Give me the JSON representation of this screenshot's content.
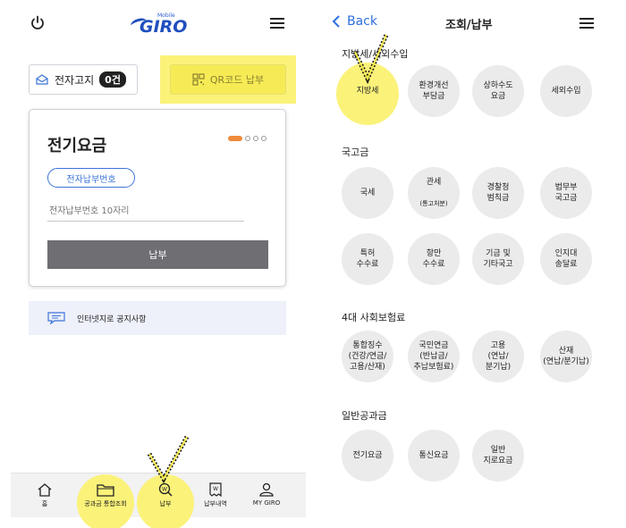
{
  "left": {
    "logo": {
      "small": "Mobile",
      "brand": "GIRO"
    },
    "e_notice": {
      "label": "전자고지",
      "count": "0건"
    },
    "qr_button": {
      "label": "QR코드 납부"
    },
    "card": {
      "title": "전기요금",
      "e_pay_number_label": "전자납부번호",
      "input_placeholder": "전자납부번호 10자리",
      "pay_label": "납부"
    },
    "notice": {
      "label": "인터넷지로 공지사항"
    },
    "bottom_nav": [
      {
        "label": "홈"
      },
      {
        "label": "공과금 통합조회"
      },
      {
        "label": "납부"
      },
      {
        "label": "납부내역"
      },
      {
        "label": "MY GIRO"
      }
    ]
  },
  "right": {
    "back_label": "Back",
    "title": "조회/납부",
    "sections": [
      {
        "title": "지방세/세외수입",
        "items": [
          {
            "label": "지방세"
          },
          {
            "label": "환경개선\n부담금"
          },
          {
            "label": "상하수도\n요금"
          },
          {
            "label": "세외수입"
          }
        ]
      },
      {
        "title": "국고금",
        "items": [
          {
            "label": "국세"
          },
          {
            "label": "관세",
            "sub": "(통고처분)"
          },
          {
            "label": "경찰청\n범칙금"
          },
          {
            "label": "법무부\n국고금"
          },
          {
            "label": "특허\n수수료"
          },
          {
            "label": "항만\n수수료"
          },
          {
            "label": "기금 및\n기타국고"
          },
          {
            "label": "인지대\n송달료"
          }
        ]
      },
      {
        "title": "4대 사회보험료",
        "items": [
          {
            "label": "통합징수\n(건강/연금/\n고용/산재)"
          },
          {
            "label": "국민연금\n(반납금/\n추납보험료)"
          },
          {
            "label": "고용\n(연납/\n분기납)"
          },
          {
            "label": "산재\n(연납/분기납)"
          }
        ]
      },
      {
        "title": "일반공과금",
        "items": [
          {
            "label": "전기요금"
          },
          {
            "label": "통신요금"
          },
          {
            "label": "일반\n지로요금"
          }
        ]
      }
    ]
  },
  "colors": {
    "highlight": "#fbf27a",
    "accent_blue": "#2f6fe0",
    "pay_button": "#6e6e73",
    "page_dot_active": "#f08a3c"
  }
}
